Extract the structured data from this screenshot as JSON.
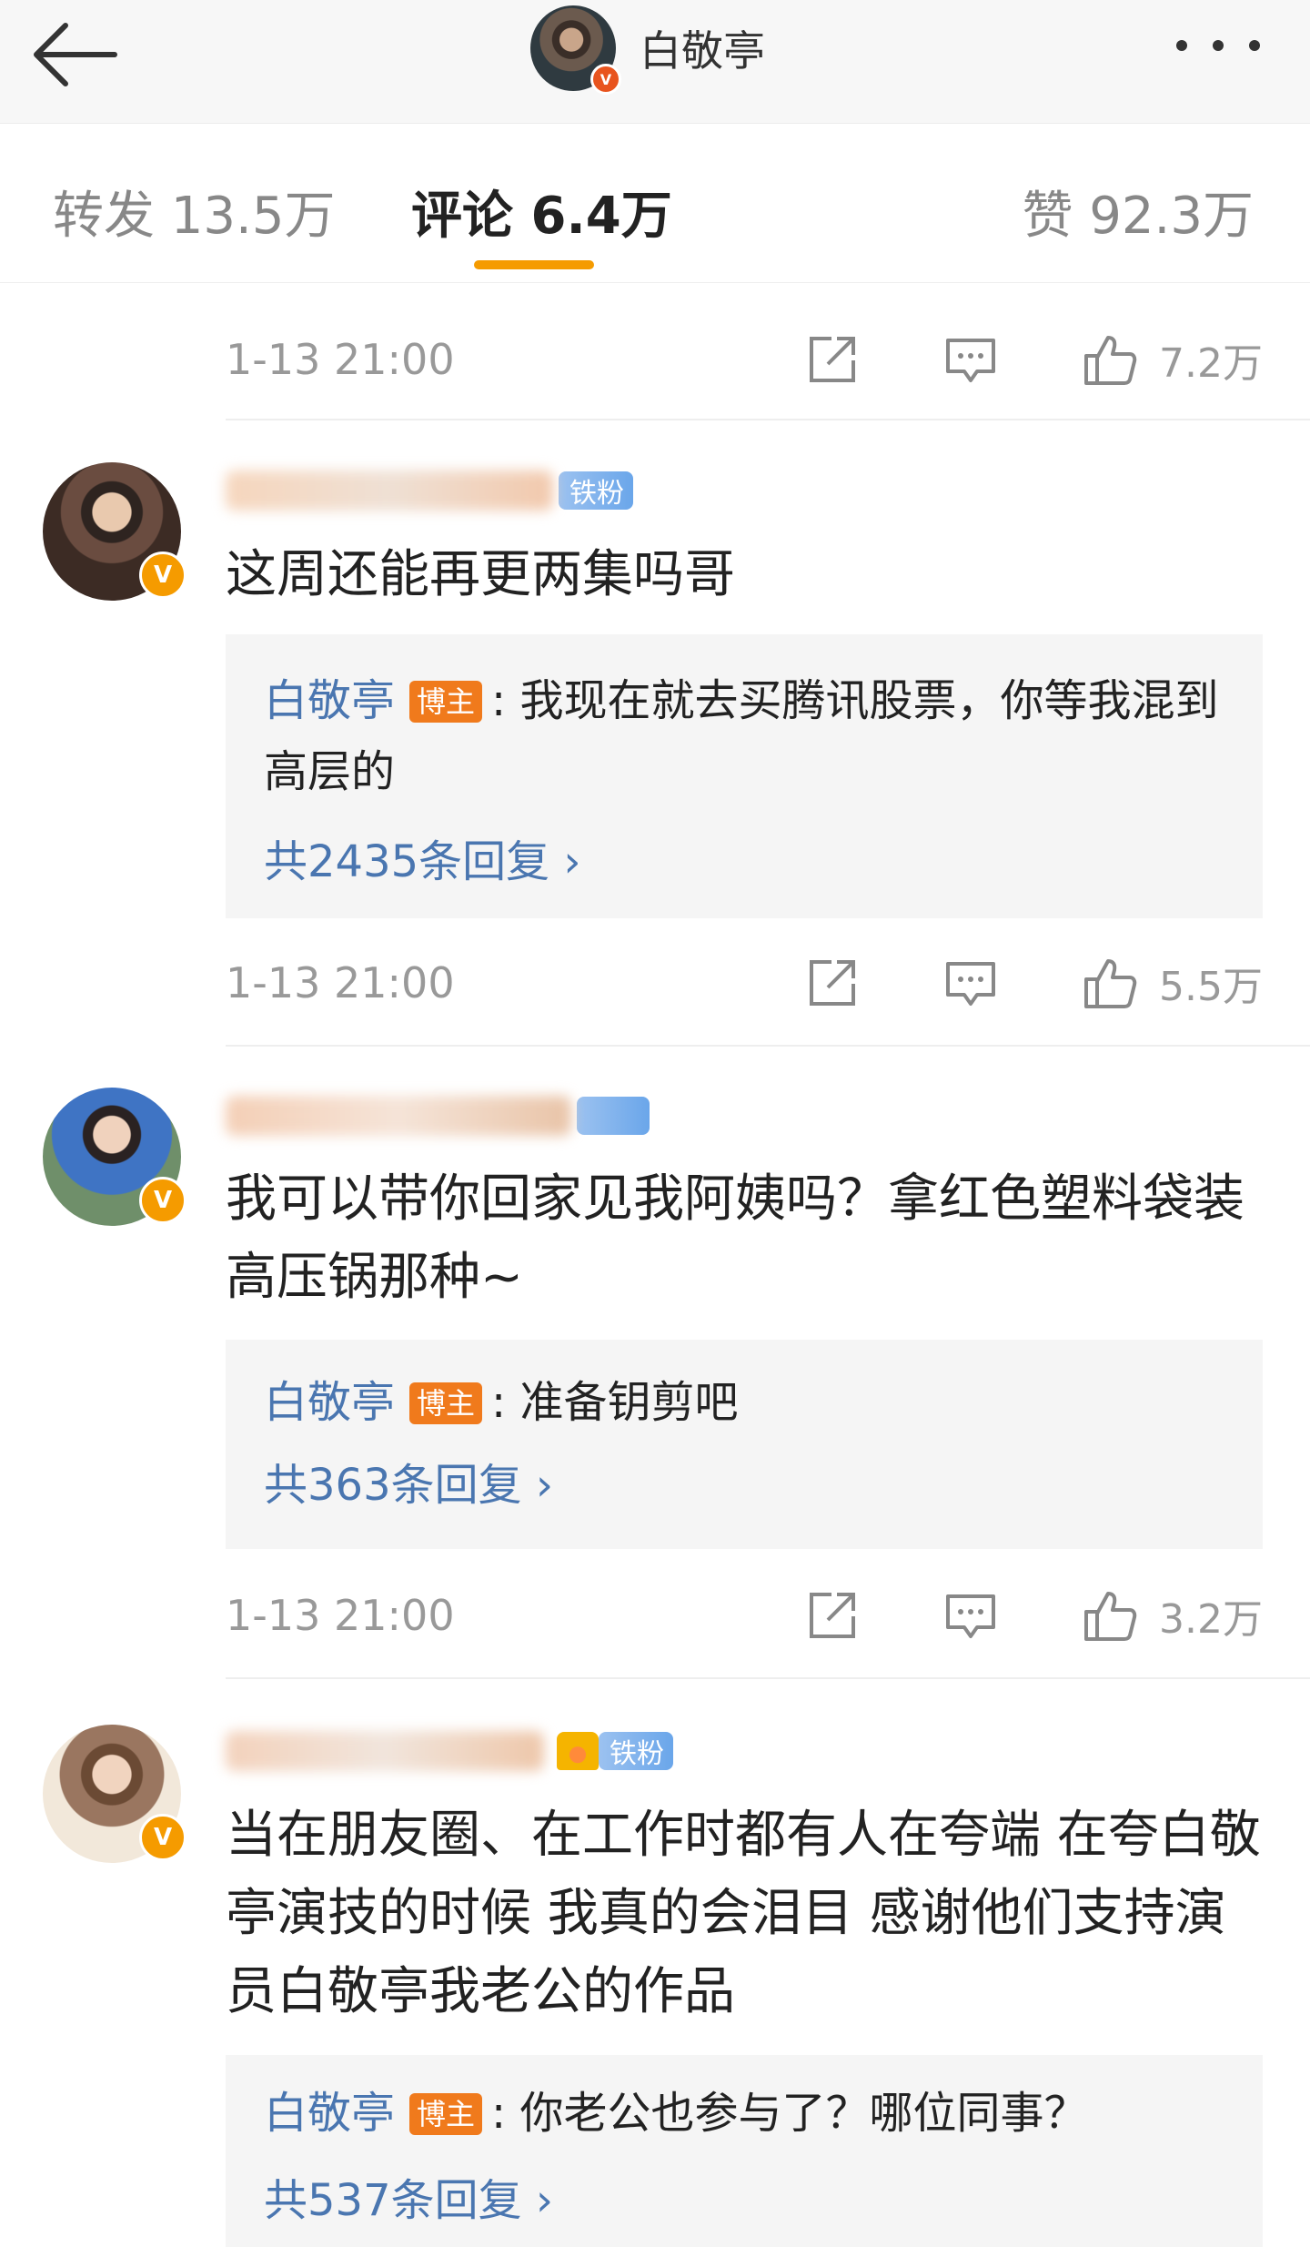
{
  "header": {
    "title": "白敬亭"
  },
  "tabs": [
    {
      "label": "转发 13.5万"
    },
    {
      "label": "评论 6.4万"
    },
    {
      "label": "赞 92.3万"
    }
  ],
  "colors": {
    "accent": "#f59b00",
    "link": "#4a76b0",
    "host_badge": "#f07a1c"
  },
  "top_comment": {
    "time": "1-13 21:00",
    "likes": "7.2万"
  },
  "comments": [
    {
      "badge": "铁粉",
      "text": "这周还能再更两集吗哥",
      "reply": {
        "author": "白敬亭",
        "host_label": "博主",
        "text": ": 我现在就去买腾讯股票，你等我混到高层的"
      },
      "reply_count": "共2435条回复 ›",
      "time": "1-13 21:00",
      "likes": "5.5万"
    },
    {
      "text": "我可以带你回家见我阿姨吗？拿红色塑料袋装高压锅那种~",
      "reply": {
        "author": "白敬亭",
        "host_label": "博主",
        "text": ": 准备钥剪吧"
      },
      "reply_count": "共363条回复 ›",
      "time": "1-13 21:00",
      "likes": "3.2万"
    },
    {
      "badge": "铁粉",
      "text": "当在朋友圈、在工作时都有人在夸端  在夸白敬亭演技的时候  我真的会泪目  感谢他们支持演员白敬亭我老公的作品",
      "reply": {
        "author": "白敬亭",
        "host_label": "博主",
        "text": ": 你老公也参与了？哪位同事？"
      },
      "reply_count": "共537条回复 ›"
    }
  ]
}
